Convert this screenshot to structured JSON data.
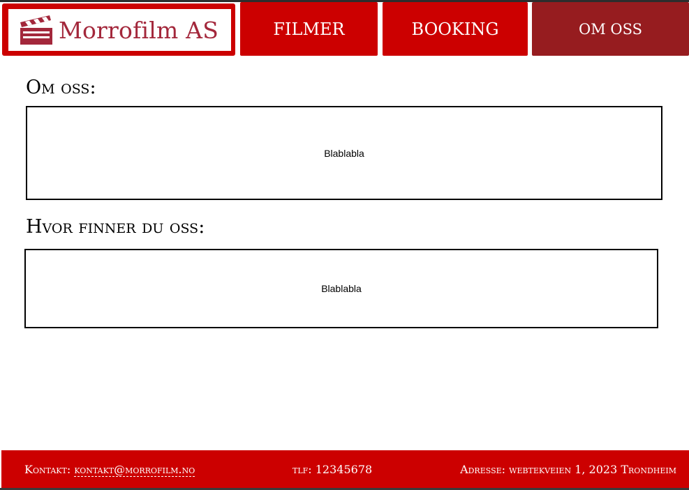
{
  "header": {
    "logo_text": "Morrofilm AS",
    "nav": [
      {
        "label": "FILMER"
      },
      {
        "label": "BOOKING"
      },
      {
        "label": "OM OSS"
      }
    ]
  },
  "main": {
    "sections": [
      {
        "title": "Om oss:",
        "body": "Blablabla"
      },
      {
        "title": "Hvor finner du oss:",
        "body": "Blablabla"
      }
    ]
  },
  "footer": {
    "contact_label": "Kontakt:",
    "contact_email": "kontakt@morrofilm.no",
    "phone": "tlf: 12345678",
    "address": "Adresse: webtekveien 1, 2023 Trondheim"
  },
  "colors": {
    "brand_red": "#cc0000",
    "active_red": "#961c1f",
    "logo_text": "#a3273b"
  },
  "icons": {
    "logo": "clapperboard-icon"
  }
}
